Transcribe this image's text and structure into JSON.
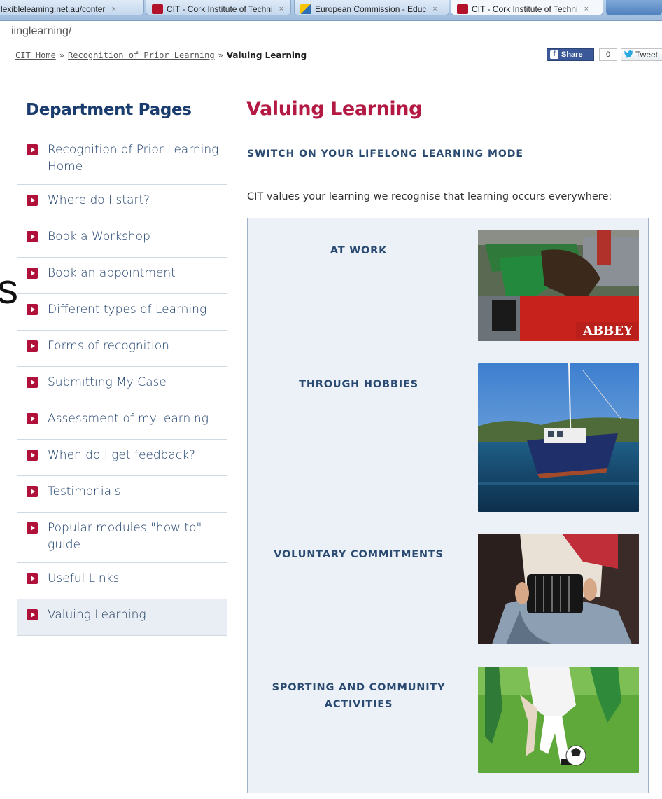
{
  "browser": {
    "tabs": [
      {
        "label": "lexibleleaming.net.au/conter",
        "active": false
      },
      {
        "label": "CIT - Cork Institute of Techni",
        "active": false
      },
      {
        "label": "European Commission - Educ",
        "active": false
      },
      {
        "label": "CIT - Cork Institute of Techni",
        "active": true
      }
    ],
    "tab_close_glyph": "×",
    "address": "iinglearning/"
  },
  "breadcrumb": {
    "home": "CIT Home",
    "parent": "Recognition of Prior Learning",
    "current": "Valuing Learning",
    "separator": "»"
  },
  "social": {
    "share_label": "Share",
    "share_icon": "f",
    "share_count": "0",
    "tweet_label": "Tweet"
  },
  "stray_letter": "s",
  "sidebar": {
    "title": "Department Pages",
    "items": [
      {
        "label": "Recognition of Prior Learning Home",
        "active": false
      },
      {
        "label": "Where do I start?",
        "active": false
      },
      {
        "label": "Book a Workshop",
        "active": false
      },
      {
        "label": "Book an appointment",
        "active": false
      },
      {
        "label": "Different types of Learning",
        "active": false
      },
      {
        "label": "Forms of recognition",
        "active": false
      },
      {
        "label": "Submitting My Case",
        "active": false
      },
      {
        "label": "Assessment of my learning",
        "active": false
      },
      {
        "label": "When do I get feedback?",
        "active": false
      },
      {
        "label": "Testimonials",
        "active": false
      },
      {
        "label": "Popular modules \"how to\" guide",
        "active": false
      },
      {
        "label": "Useful Links",
        "active": false
      },
      {
        "label": "Valuing Learning",
        "active": true
      }
    ]
  },
  "main": {
    "title": "Valuing Learning",
    "subheading": "SWITCH ON YOUR LIFELONG LEARNING MODE",
    "intro": "CIT values your learning we recognise that learning occurs everywhere:",
    "rows": [
      {
        "label": "AT WORK",
        "image": "tractor-photo",
        "image_text": "ABBEY"
      },
      {
        "label": "THROUGH HOBBIES",
        "image": "sailboat-photo"
      },
      {
        "label": "VOLUNTARY COMMITMENTS",
        "image": "concertina-photo"
      },
      {
        "label": "SPORTING AND COMMUNITY ACTIVITIES",
        "image": "football-photo"
      }
    ]
  },
  "colors": {
    "accent": "#b31942",
    "nav_text": "#1d3f6b",
    "table_bg": "#ebf1f6"
  }
}
